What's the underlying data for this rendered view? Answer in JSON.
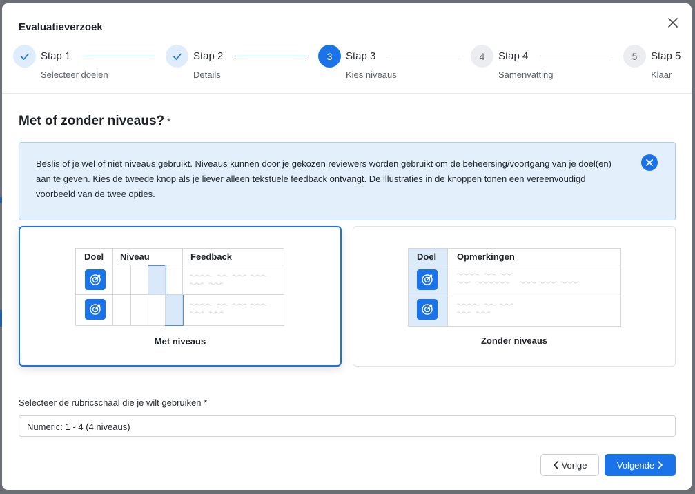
{
  "dialog": {
    "title": "Evaluatieverzoek"
  },
  "stepper": {
    "steps": [
      {
        "number": "1",
        "label": "Stap 1",
        "sublabel": "Selecteer doelen",
        "state": "done"
      },
      {
        "number": "2",
        "label": "Stap 2",
        "sublabel": "Details",
        "state": "done"
      },
      {
        "number": "3",
        "label": "Stap 3",
        "sublabel": "Kies niveaus",
        "state": "active"
      },
      {
        "number": "4",
        "label": "Stap 4",
        "sublabel": "Samenvatting",
        "state": "todo"
      },
      {
        "number": "5",
        "label": "Stap 5",
        "sublabel": "Klaar",
        "state": "todo"
      }
    ]
  },
  "section": {
    "title": "Met of zonder niveaus?",
    "required_mark": "*"
  },
  "info": {
    "text": "Beslis of je wel of niet niveaus gebruikt. Niveaus kunnen door je gekozen reviewers worden gebruikt om de beheersing/voortgang van je doel(en) aan te geven. Kies de tweede knop als je liever alleen tekstuele feedback ontvangt. De illustraties in de knoppen tonen een vereenvoudigd voorbeeld van de twee opties."
  },
  "options": {
    "with_levels": {
      "label": "Met niveaus",
      "selected": true,
      "headers": {
        "goal": "Doel",
        "level": "Niveau",
        "feedback": "Feedback"
      }
    },
    "without_levels": {
      "label": "Zonder niveaus",
      "selected": false,
      "headers": {
        "goal": "Doel",
        "remarks": "Opmerkingen"
      }
    }
  },
  "rubric": {
    "label": "Selecteer de rubricschaal die je wilt gebruiken *",
    "value": "Numeric: 1 - 4 (4 niveaus)"
  },
  "footer": {
    "prev_label": "Vorige",
    "next_label": "Volgende"
  },
  "colors": {
    "accent": "#1a73e8",
    "info_bg": "#e3f0fc"
  }
}
